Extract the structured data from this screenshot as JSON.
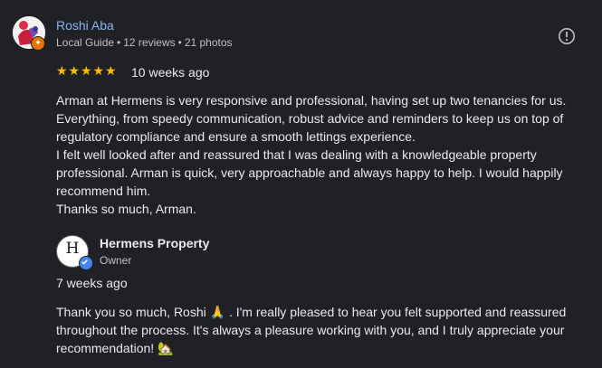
{
  "review": {
    "reviewer": {
      "name": "Roshi Aba",
      "level": "Local Guide",
      "reviews_count": "12 reviews",
      "photos_count": "21 photos",
      "separator": "•"
    },
    "rating": 5,
    "rating_max": 5,
    "star_glyph": "★",
    "date": "10 weeks ago",
    "text_lines": [
      "Arman at Hermens is very responsive and professional, having set up two tenancies for us.",
      "Everything, from speedy communication, robust advice and reminders to keep us on top of",
      "regulatory compliance and ensure a smooth lettings experience.",
      "I felt well looked after and reassured that I was dealing with a knowledgeable property",
      "professional. Arman is quick, very approachable and always happy to help. I would happily",
      "recommend him.",
      "Thanks so much, Arman."
    ],
    "icons": {
      "report": "report-icon",
      "guide_badge": "local-guide-badge-icon"
    }
  },
  "owner_response": {
    "name": "Hermens Property",
    "role": "Owner",
    "date": "7 weeks ago",
    "logo_letter": "H",
    "text_lines": [
      "Thank you so much, Roshi 🙏 . I'm really pleased to hear you felt supported and reassured",
      "throughout the process. It's always a pleasure working with you, and I truly appreciate your",
      "recommendation! 🏡"
    ],
    "icons": {
      "verified": "verified-check-icon"
    }
  },
  "colors": {
    "background": "#202124",
    "link": "#8ab4f8",
    "star": "#fbbc04",
    "text": "#e8eaed",
    "secondary_text": "#bdc1c6",
    "local_guide_badge": "#e37400",
    "verified_badge": "#4285f4"
  }
}
